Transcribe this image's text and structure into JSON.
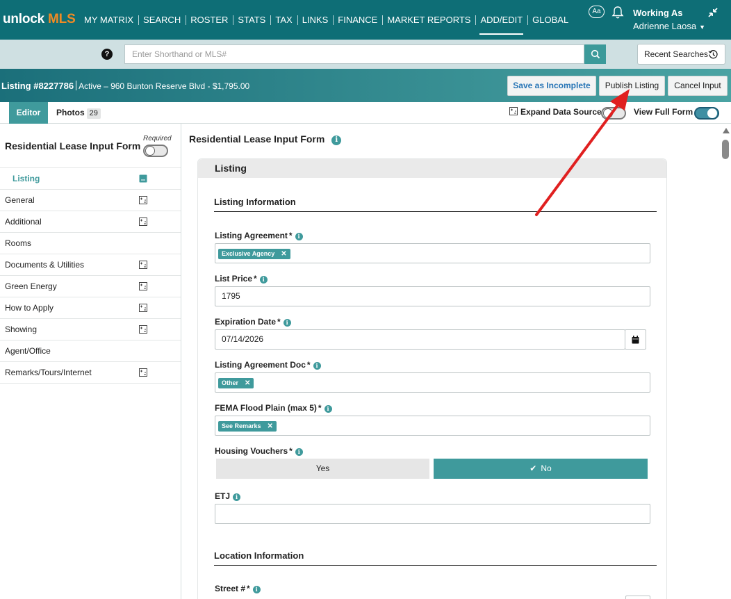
{
  "logo": {
    "part1": "unlock",
    "part2": "MLS"
  },
  "nav": {
    "items": [
      "MY MATRIX",
      "SEARCH",
      "ROSTER",
      "STATS",
      "TAX",
      "LINKS",
      "FINANCE",
      "MARKET REPORTS",
      "ADD/EDIT",
      "GLOBAL"
    ],
    "active": "ADD/EDIT",
    "font_size_button": "Aa",
    "working_as_label": "Working As",
    "agent_name": "Adrienne Laosa"
  },
  "search": {
    "help": "?",
    "placeholder": "Enter Shorthand or MLS#",
    "recent_searches": "Recent Searches"
  },
  "listing": {
    "number": "Listing #8227786",
    "status_line": "Active – 960 Bunton Reserve Blvd - $1,795.00",
    "save_incomplete": "Save as Incomplete",
    "publish": "Publish Listing",
    "cancel": "Cancel Input"
  },
  "tabs": {
    "editor": "Editor",
    "photos": "Photos",
    "photos_count": "29",
    "expand_data_source": "Expand Data Source",
    "view_full_form": "View Full Form"
  },
  "left": {
    "form_title": "Residential Lease Input Form",
    "required_label": "Required",
    "sections": [
      {
        "label": "Listing",
        "active": true,
        "icon": true
      },
      {
        "label": "General",
        "icon": true
      },
      {
        "label": "Additional",
        "icon": true
      },
      {
        "label": "Rooms",
        "icon": false
      },
      {
        "label": "Documents & Utilities",
        "icon": true
      },
      {
        "label": "Green Energy",
        "icon": true
      },
      {
        "label": "How to Apply",
        "icon": true
      },
      {
        "label": "Showing",
        "icon": true
      },
      {
        "label": "Agent/Office",
        "icon": false
      },
      {
        "label": "Remarks/Tours/Internet",
        "icon": true
      }
    ]
  },
  "main": {
    "title": "Residential Lease Input Form",
    "card_title": "Listing",
    "listing_info": "Listing Information",
    "location_info": "Location Information",
    "fields": {
      "listing_agreement": {
        "label": "Listing Agreement",
        "chip": "Exclusive Agency"
      },
      "list_price": {
        "label": "List Price",
        "value": "1795"
      },
      "expiration_date": {
        "label": "Expiration Date",
        "value": "07/14/2026"
      },
      "listing_agreement_doc": {
        "label": "Listing Agreement Doc",
        "chip": "Other"
      },
      "fema_flood_plain": {
        "label": "FEMA Flood Plain (max 5)",
        "chip": "See Remarks"
      },
      "housing_vouchers": {
        "label": "Housing Vouchers",
        "yes": "Yes",
        "no": "No",
        "selected": "No"
      },
      "etj": {
        "label": "ETJ",
        "value": ""
      },
      "street_no": {
        "label": "Street #"
      }
    },
    "required_star": "*",
    "info_glyph": "i",
    "chip_remove": "✕",
    "check_glyph": "✔"
  },
  "colors": {
    "nav_bg": "#0e6e76",
    "accent": "#3f9a9c",
    "logo_orange": "#f08a24",
    "annotation_arrow": "#e02020"
  }
}
